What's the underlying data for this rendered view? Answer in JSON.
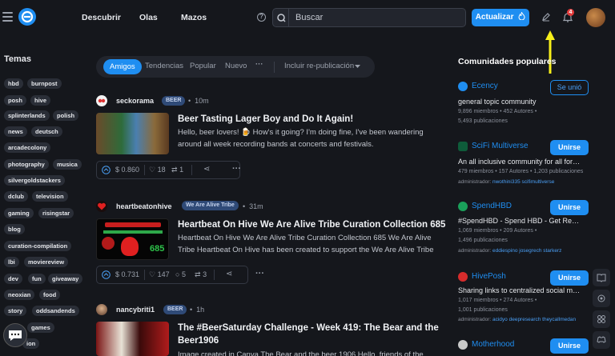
{
  "nav": {
    "discover": "Descubrir",
    "waves": "Olas",
    "decks": "Mazos"
  },
  "search": {
    "placeholder": "Buscar"
  },
  "update_button": "Actualizar",
  "notification_count": "4",
  "sidebar": {
    "title": "Temas",
    "tags": [
      "hbd",
      "burnpost",
      "posh",
      "hive",
      "splinterlands",
      "polish",
      "news",
      "deutsch",
      "arcadecolony",
      "photography",
      "musica",
      "silvergoldstackers",
      "dclub",
      "television",
      "gaming",
      "risingstar",
      "blog",
      "curation-compilation",
      "lbi",
      "moviereview",
      "dev",
      "fun",
      "giveaway",
      "neoxian",
      "food",
      "story",
      "oddsandends",
      "games",
      "ion"
    ]
  },
  "tabs": {
    "items": [
      "Amigos",
      "Tendencias",
      "Popular",
      "Nuevo"
    ],
    "more": "···",
    "include": "Incluir re-publicación"
  },
  "posts": [
    {
      "author": "seckorama",
      "community": "BEER",
      "time": "10m",
      "title": "Beer Tasting Lager Boy and Do It Again!",
      "excerpt": "Hello, beer lovers! 🍺 How's it going? I'm doing fine, I've been wandering around all week recording bands at concerts and festivals.",
      "payout": "$ 0.860",
      "votes": "18",
      "reblogs": "1",
      "comments": ""
    },
    {
      "author": "heartbeatonhive",
      "community": "We Are Alive Tribe",
      "time": "31m",
      "title": "Heartbeat On Hive We Are Alive Tribe Curation Collection 685",
      "excerpt": "Heartbeat On Hive We Are Alive Tribe Curation Collection 685 We Are Alive Tribe Heartbeat On Hive has been created to support the We Are Alive Tribe",
      "payout": "$ 0.731",
      "votes": "147",
      "comments": "5",
      "reblogs": "3",
      "thumb_text": "685"
    },
    {
      "author": "nancybriti1",
      "community": "BEER",
      "time": "1h",
      "title": "The #BeerSaturday Challenge - Week 419: The Bear and the Beer1906",
      "excerpt": "Image created in Canva The Bear and the beer 1906 Hello, friends of the"
    }
  ],
  "communities": {
    "title": "Comunidades populares",
    "items": [
      {
        "name": "Ecency",
        "desc": "general topic community",
        "stats1": "9,896 miembros  •  452 Autores  •",
        "stats2": "5,493 publicaciones",
        "button": "Se unió",
        "joined": true,
        "color": "#1f8ef1"
      },
      {
        "name": "SciFi Multiverse",
        "desc": "An all inclusive community for all forms...",
        "stats1": "479 miembros  •  157 Autores  •  1,203 publicaciones",
        "admin_label": "administrador:",
        "admins": "nwothini335 scifimultiverse",
        "button": "Unirse",
        "joined": false,
        "color": "#0e5c3a"
      },
      {
        "name": "SpendHBD",
        "desc": "#SpendHBD - Spend HBD - Get Reward...",
        "stats1": "1,069 miembros  •  209 Autores  •",
        "stats2": "1,496 publicaciones",
        "admin_label": "administrador:",
        "admins": "eddiespino josegrech starkerz",
        "button": "Unirse",
        "joined": false,
        "color": "#1aa05a"
      },
      {
        "name": "HivePosh",
        "desc": "Sharing links to centralized social medi...",
        "stats1": "1,017 miembros  •  274 Autores  •",
        "stats2": "1,001 publicaciones",
        "admin_label": "administrador:",
        "admins": "acidyo deepresearch theycallmedan",
        "button": "Unirse",
        "joined": false,
        "color": "#d62c2c"
      },
      {
        "name": "Motherhood",
        "button": "Unirse",
        "joined": false,
        "color": "#c9c9c9"
      }
    ]
  }
}
